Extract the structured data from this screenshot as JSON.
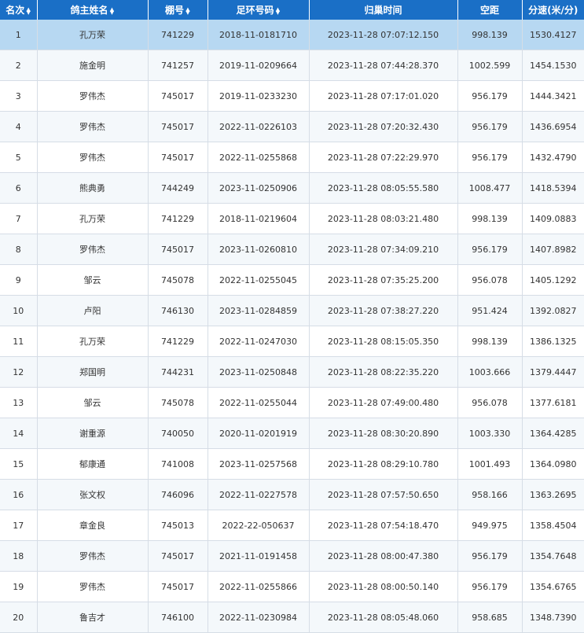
{
  "table": {
    "headers": [
      {
        "label": "名次",
        "sortable": true
      },
      {
        "label": "鸽主姓名",
        "sortable": true
      },
      {
        "label": "棚号",
        "sortable": true
      },
      {
        "label": "足环号码",
        "sortable": true
      },
      {
        "label": "归巢时间",
        "sortable": false
      },
      {
        "label": "空距",
        "sortable": false
      },
      {
        "label": "分速(米/分)",
        "sortable": false
      }
    ],
    "selected_row": 0,
    "rows": [
      [
        "1",
        "孔万荣",
        "741229",
        "2018-11-0181710",
        "2023-11-28 07:07:12.150",
        "998.139",
        "1530.4127"
      ],
      [
        "2",
        "施金明",
        "741257",
        "2019-11-0209664",
        "2023-11-28 07:44:28.370",
        "1002.599",
        "1454.1530"
      ],
      [
        "3",
        "罗伟杰",
        "745017",
        "2019-11-0233230",
        "2023-11-28 07:17:01.020",
        "956.179",
        "1444.3421"
      ],
      [
        "4",
        "罗伟杰",
        "745017",
        "2022-11-0226103",
        "2023-11-28 07:20:32.430",
        "956.179",
        "1436.6954"
      ],
      [
        "5",
        "罗伟杰",
        "745017",
        "2022-11-0255868",
        "2023-11-28 07:22:29.970",
        "956.179",
        "1432.4790"
      ],
      [
        "6",
        "熊典勇",
        "744249",
        "2023-11-0250906",
        "2023-11-28 08:05:55.580",
        "1008.477",
        "1418.5394"
      ],
      [
        "7",
        "孔万荣",
        "741229",
        "2018-11-0219604",
        "2023-11-28 08:03:21.480",
        "998.139",
        "1409.0883"
      ],
      [
        "8",
        "罗伟杰",
        "745017",
        "2023-11-0260810",
        "2023-11-28 07:34:09.210",
        "956.179",
        "1407.8982"
      ],
      [
        "9",
        "邹云",
        "745078",
        "2022-11-0255045",
        "2023-11-28 07:35:25.200",
        "956.078",
        "1405.1292"
      ],
      [
        "10",
        "卢阳",
        "746130",
        "2023-11-0284859",
        "2023-11-28 07:38:27.220",
        "951.424",
        "1392.0827"
      ],
      [
        "11",
        "孔万荣",
        "741229",
        "2022-11-0247030",
        "2023-11-28 08:15:05.350",
        "998.139",
        "1386.1325"
      ],
      [
        "12",
        "郑国明",
        "744231",
        "2023-11-0250848",
        "2023-11-28 08:22:35.220",
        "1003.666",
        "1379.4447"
      ],
      [
        "13",
        "邹云",
        "745078",
        "2022-11-0255044",
        "2023-11-28 07:49:00.480",
        "956.078",
        "1377.6181"
      ],
      [
        "14",
        "谢重源",
        "740050",
        "2020-11-0201919",
        "2023-11-28 08:30:20.890",
        "1003.330",
        "1364.4285"
      ],
      [
        "15",
        "郁康通",
        "741008",
        "2023-11-0257568",
        "2023-11-28 08:29:10.780",
        "1001.493",
        "1364.0980"
      ],
      [
        "16",
        "张文权",
        "746096",
        "2022-11-0227578",
        "2023-11-28 07:57:50.650",
        "958.166",
        "1363.2695"
      ],
      [
        "17",
        "章金良",
        "745013",
        "2022-22-050637",
        "2023-11-28 07:54:18.470",
        "949.975",
        "1358.4504"
      ],
      [
        "18",
        "罗伟杰",
        "745017",
        "2021-11-0191458",
        "2023-11-28 08:00:47.380",
        "956.179",
        "1354.7648"
      ],
      [
        "19",
        "罗伟杰",
        "745017",
        "2022-11-0255866",
        "2023-11-28 08:00:50.140",
        "956.179",
        "1354.6765"
      ],
      [
        "20",
        "鲁吉才",
        "746100",
        "2022-11-0230984",
        "2023-11-28 08:05:48.060",
        "958.685",
        "1348.7390"
      ]
    ]
  },
  "icons": {
    "sort_up": "▲",
    "sort_down": "▼"
  },
  "colors": {
    "header_bg": "#1a6fc6",
    "selected_row_bg": "#b7d8f2",
    "alt_row_bg": "#f4f8fb"
  }
}
